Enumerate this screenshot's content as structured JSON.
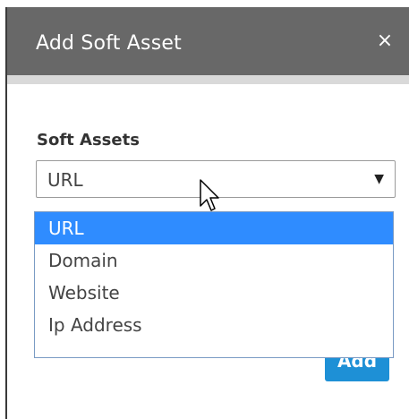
{
  "dialog": {
    "title": "Add Soft Asset",
    "close_glyph": "×"
  },
  "form": {
    "soft_assets_label": "Soft Assets",
    "selected_value": "URL",
    "dropdown_arrow": "▼",
    "options": [
      "URL",
      "Domain",
      "Website",
      "Ip Address"
    ],
    "highlighted_option": "URL"
  },
  "buttons": {
    "add_label": "Add"
  },
  "colors": {
    "header_bg": "#686868",
    "highlight": "#2f8cff",
    "add_button": "#1e90d6"
  },
  "icons": {
    "close": "close-icon",
    "dropdown": "chevron-down-icon",
    "cursor": "mouse-pointer-icon"
  }
}
